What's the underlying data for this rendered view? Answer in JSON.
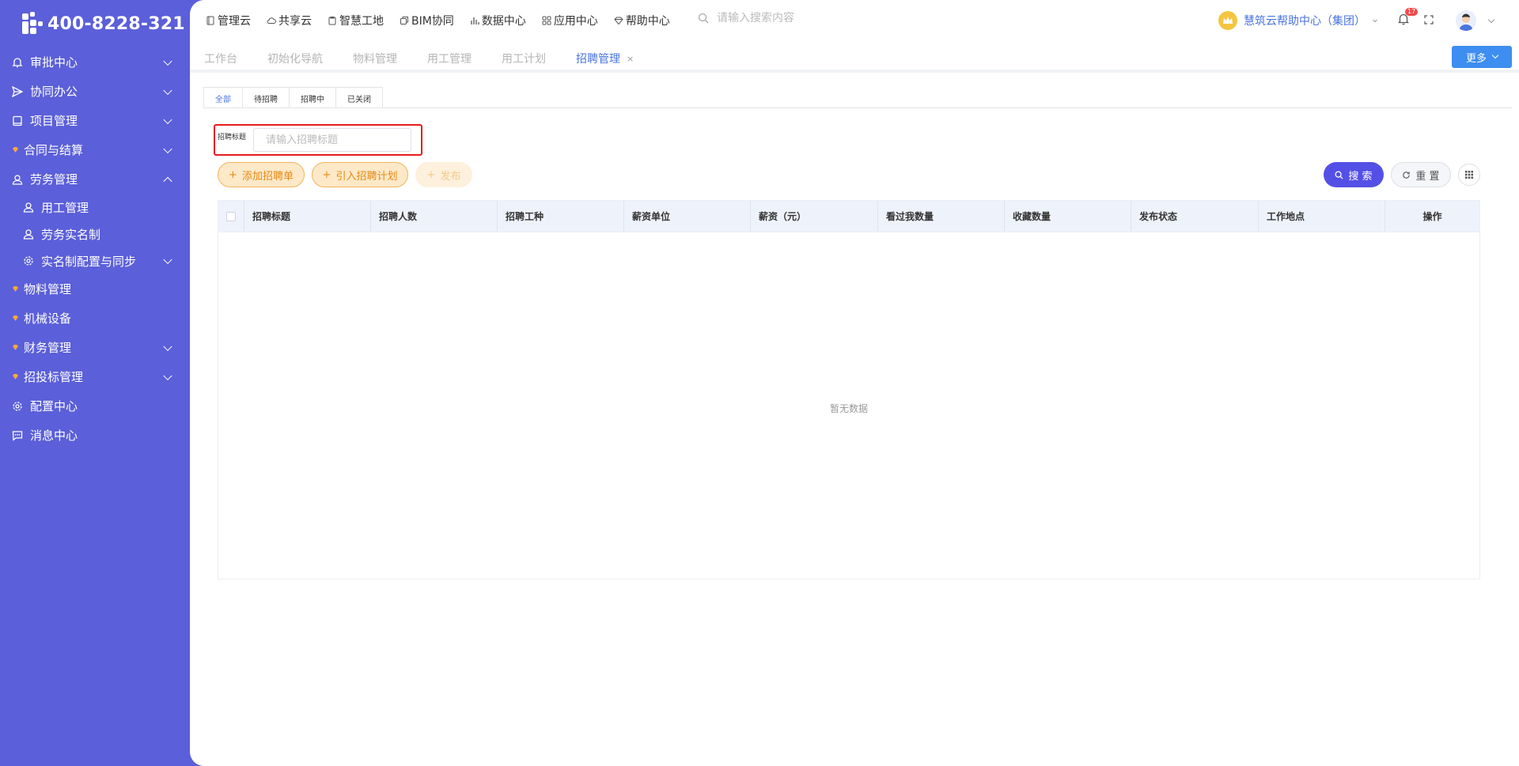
{
  "app": {
    "phone": "400-8228-321"
  },
  "sidebar": {
    "items": [
      {
        "label": "审批中心",
        "icon": "bell-icon",
        "expanded": false
      },
      {
        "label": "协同办公",
        "icon": "send-icon",
        "expanded": false
      },
      {
        "label": "项目管理",
        "icon": "book-icon",
        "expanded": false
      },
      {
        "label": "合同与结算",
        "icon": "gem-icon",
        "expanded": false
      },
      {
        "label": "劳务管理",
        "icon": "user-icon",
        "expanded": true
      },
      {
        "label": "用工管理",
        "icon": "user-icon",
        "sub": true
      },
      {
        "label": "劳务实名制",
        "icon": "user-icon",
        "sub": true
      },
      {
        "label": "实名制配置与同步",
        "icon": "gear-icon",
        "sub": true,
        "expanded": false
      },
      {
        "label": "物料管理",
        "icon": "gem-icon"
      },
      {
        "label": "机械设备",
        "icon": "gem-icon"
      },
      {
        "label": "财务管理",
        "icon": "gem-icon",
        "expanded": false
      },
      {
        "label": "招投标管理",
        "icon": "gem-icon",
        "expanded": false
      },
      {
        "label": "配置中心",
        "icon": "gear-icon"
      },
      {
        "label": "消息中心",
        "icon": "message-icon"
      }
    ]
  },
  "topnav": {
    "items": [
      "管理云",
      "共享云",
      "智慧工地",
      "BIM协同",
      "数据中心",
      "应用中心",
      "帮助中心"
    ]
  },
  "search": {
    "placeholder": "请输入搜索内容"
  },
  "header": {
    "help_center": "慧筑云帮助中心（集团）",
    "notification_count": "17"
  },
  "tabs": {
    "items": [
      "工作台",
      "初始化导航",
      "物料管理",
      "用工管理",
      "用工计划",
      "招聘管理"
    ],
    "active_index": 5,
    "more_label": "更多"
  },
  "subtabs": {
    "items": [
      "全部",
      "待招聘",
      "招聘中",
      "已关闭"
    ],
    "active_index": 0
  },
  "filter": {
    "label": "招聘标题",
    "placeholder": "请输入招聘标题"
  },
  "toolbar": {
    "add_label": "添加招聘单",
    "import_label": "引入招聘计划",
    "publish_label": "发布",
    "search_label": "搜 索",
    "reset_label": "重 置"
  },
  "table": {
    "columns": [
      "招聘标题",
      "招聘人数",
      "招聘工种",
      "薪资单位",
      "薪资（元）",
      "看过我数量",
      "收藏数量",
      "发布状态",
      "工作地点",
      "操作"
    ],
    "empty_text": "暂无数据"
  },
  "colors": {
    "sidebar_bg": "#5b5fd9",
    "accent": "#4a74e0",
    "primary_button": "#5450e6",
    "orange": "#e68a13",
    "highlight_border": "#e81c1c"
  }
}
